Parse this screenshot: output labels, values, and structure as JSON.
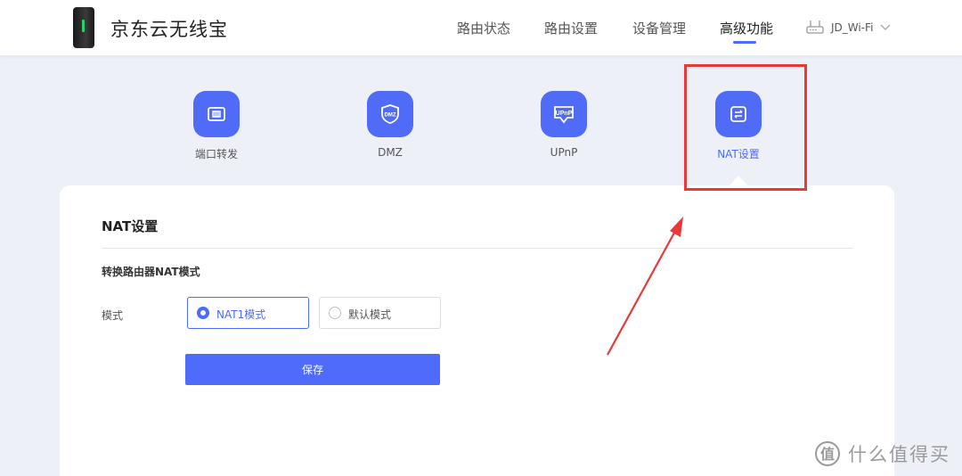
{
  "header": {
    "brand_name": "京东云无线宝",
    "nav": [
      {
        "label": "路由状态"
      },
      {
        "label": "路由设置"
      },
      {
        "label": "设备管理"
      },
      {
        "label": "高级功能",
        "active": true
      }
    ],
    "wifi_name": "JD_Wi-Fi"
  },
  "tiles": [
    {
      "label": "端口转发",
      "icon": "port-forward-icon"
    },
    {
      "label": "DMZ",
      "icon": "dmz-icon",
      "icon_text": "DMZ"
    },
    {
      "label": "UPnP",
      "icon": "upnp-icon",
      "icon_text": "UPnP"
    },
    {
      "label": "NAT设置",
      "icon": "nat-icon",
      "active": true
    }
  ],
  "panel": {
    "title": "NAT设置",
    "section_title": "转换路由器NAT模式",
    "mode_label": "模式",
    "options": [
      {
        "label": "NAT1模式",
        "selected": true
      },
      {
        "label": "默认模式",
        "selected": false
      }
    ],
    "save_label": "保存"
  },
  "watermark": {
    "text": "什么值得买"
  },
  "colors": {
    "accent": "#4b6bfb",
    "annotation": "#e8393a",
    "background": "#eef0f7"
  }
}
